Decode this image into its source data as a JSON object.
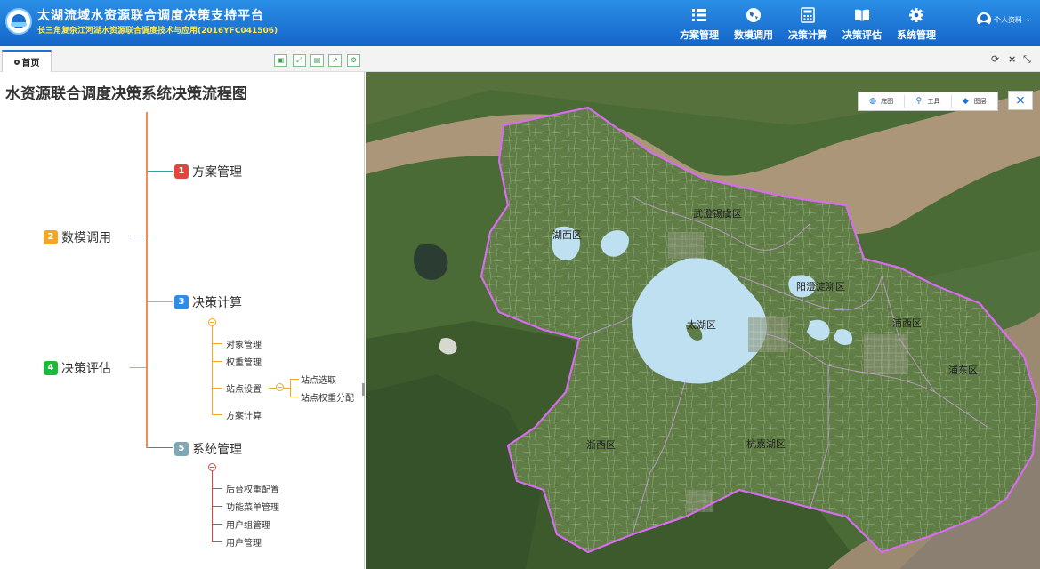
{
  "header": {
    "title": "太湖流域水资源联合调度决策支持平台",
    "subtitle": "长三角复杂江河湖水资源联合调度技术与应用(2016YFC041506)",
    "nav": [
      {
        "label": "方案管理",
        "icon": "list-icon"
      },
      {
        "label": "数模调用",
        "icon": "globe-icon"
      },
      {
        "label": "决策计算",
        "icon": "calculator-icon"
      },
      {
        "label": "决策评估",
        "icon": "book-icon"
      },
      {
        "label": "系统管理",
        "icon": "gear-icon"
      }
    ],
    "user_label": "个人资料"
  },
  "tabs": {
    "home": "首页"
  },
  "flow": {
    "title": "水资源联合调度决策系统决策流程图",
    "nodes": [
      {
        "num": "1",
        "label": "方案管理",
        "color": "#e2453c"
      },
      {
        "num": "2",
        "label": "数模调用",
        "color": "#f5a623"
      },
      {
        "num": "3",
        "label": "决策计算",
        "color": "#2d8ce8"
      },
      {
        "num": "4",
        "label": "决策评估",
        "color": "#1dba3a"
      },
      {
        "num": "5",
        "label": "系统管理",
        "color": "#7fa8b6"
      }
    ],
    "calc_items": [
      "对象管理",
      "权重管理",
      "站点设置",
      "方案计算"
    ],
    "site_items": [
      "站点选取",
      "站点权重分配"
    ],
    "sys_items": [
      "后台权重配置",
      "功能菜单管理",
      "用户组管理",
      "用户管理"
    ]
  },
  "map": {
    "tools": [
      {
        "label": "底图",
        "icon": "globe-icon"
      },
      {
        "label": "工具",
        "icon": "wrench-icon"
      },
      {
        "label": "图层",
        "icon": "layers-icon"
      }
    ],
    "regions": [
      "武澄锡虞区",
      "湖西区",
      "阳澄淀泖区",
      "太湖区",
      "浦西区",
      "浦东区",
      "浙西区",
      "杭嘉湖区"
    ]
  }
}
